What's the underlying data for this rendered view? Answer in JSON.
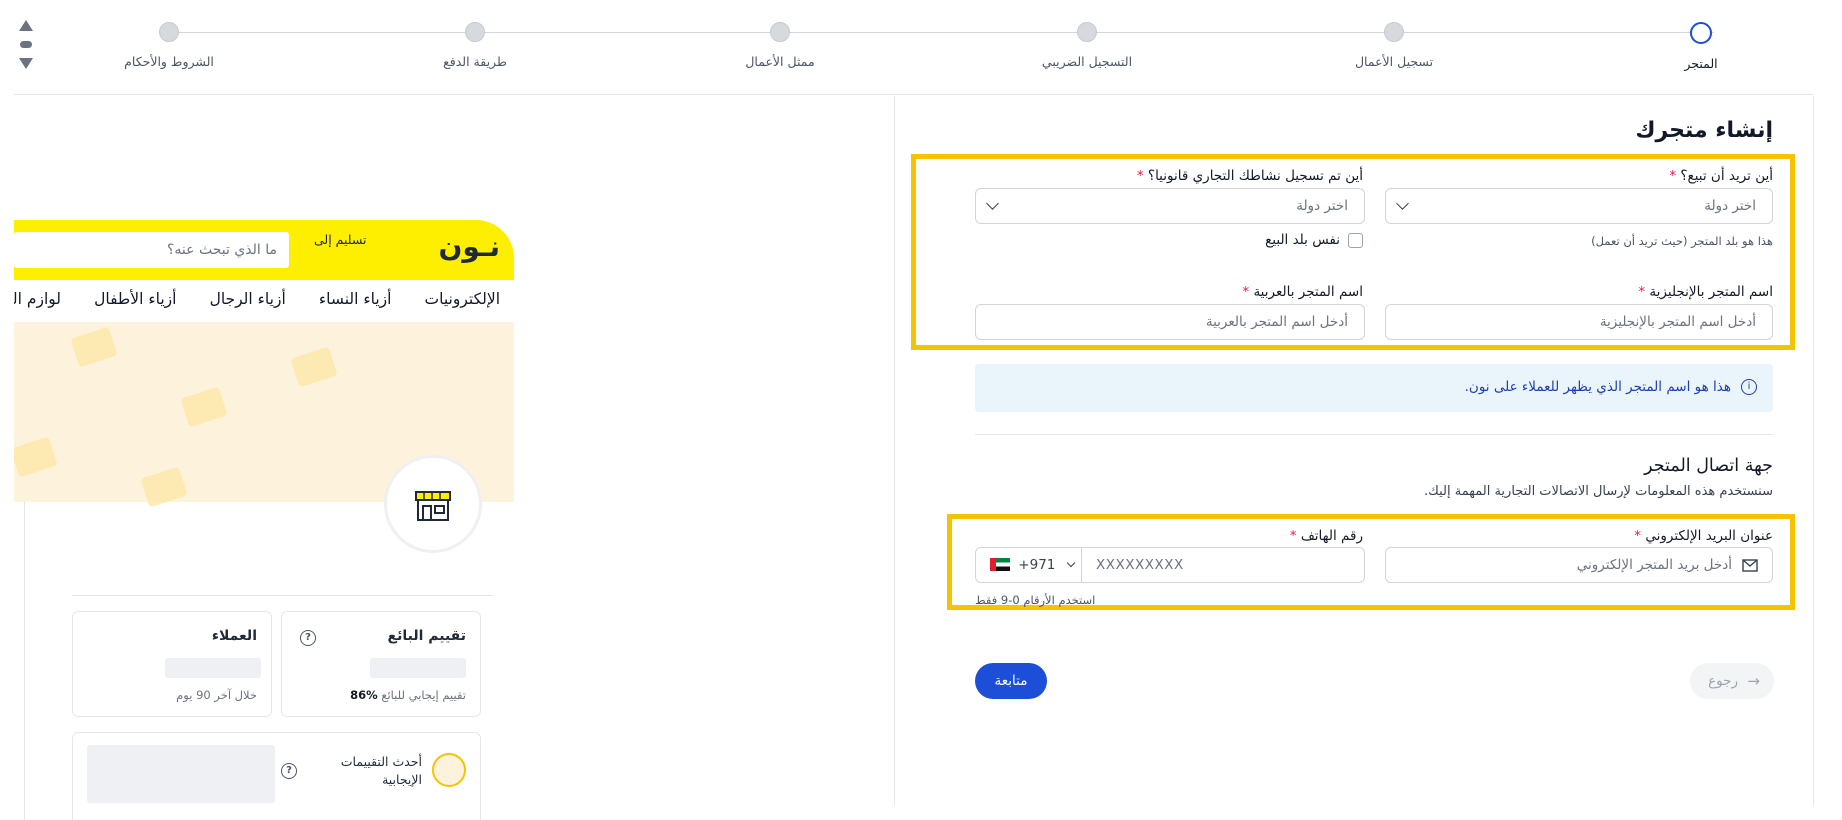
{
  "stepper": {
    "steps": [
      {
        "label": "المتجر"
      },
      {
        "label": "تسجيل الأعمال"
      },
      {
        "label": "التسجيل الضريبي"
      },
      {
        "label": "ممثل الأعمال"
      },
      {
        "label": "طريقة الدفع"
      },
      {
        "label": "الشروط والأحكام"
      }
    ]
  },
  "preview": {
    "logo": "نـون",
    "deliver_to": "تسليم إلى",
    "search_placeholder": "ما الذي تبحث عنه؟",
    "nav": [
      "الإلكترونيات",
      "أزياء النساء",
      "أزياء الرجال",
      "أزياء الأطفال",
      "لوازم الجمال"
    ],
    "seller_rating_title": "تقييم البائع",
    "seller_rating_percent": "86%",
    "seller_rating_text": "تقييم إيجابي للبائع",
    "customers_title": "العملاء",
    "customers_sub": "خلال آخر 90 يوم",
    "latest_reviews_title": "أحدث التقييمات الإيجابية"
  },
  "form": {
    "title": "إنشاء متجرك",
    "sell_where_label": "أين تريد أن تبيع؟",
    "sell_where_placeholder": "اختر دولة",
    "sell_where_hint": "هذا هو بلد المتجر (حيث تريد أن تعمل)",
    "registered_where_label": "أين تم تسجيل نشاطك التجاري قانونيا؟",
    "registered_where_placeholder": "اختر دولة",
    "same_country_label": "نفس بلد البيع",
    "store_name_en_label": "اسم المتجر بالإنجليزية",
    "store_name_en_placeholder": "أدخل اسم المتجر بالإنجليزية",
    "store_name_ar_label": "اسم المتجر بالعربية",
    "store_name_ar_placeholder": "أدخل اسم المتجر بالعربية",
    "required_mark": "*",
    "info_text": "هذا هو اسم المتجر الذي يظهر للعملاء على نون.",
    "contact_title": "جهة اتصال المتجر",
    "contact_sub": "سنستخدم هذه المعلومات لإرسال الاتصالات التجارية المهمة إليك.",
    "email_label": "عنوان البريد الإلكتروني",
    "email_placeholder": "أدخل بريد المتجر الإلكتروني",
    "phone_label": "رقم الهاتف",
    "phone_code": "+971",
    "phone_placeholder": "XXXXXXXXX",
    "phone_hint": "استخدم الأرقام 0-9 فقط",
    "next_button": "متابعة",
    "back_button": "رجوع"
  },
  "colors": {
    "accent": "#1d4ed8",
    "highlight": "#f5c400",
    "brand_yellow": "#feee00"
  }
}
